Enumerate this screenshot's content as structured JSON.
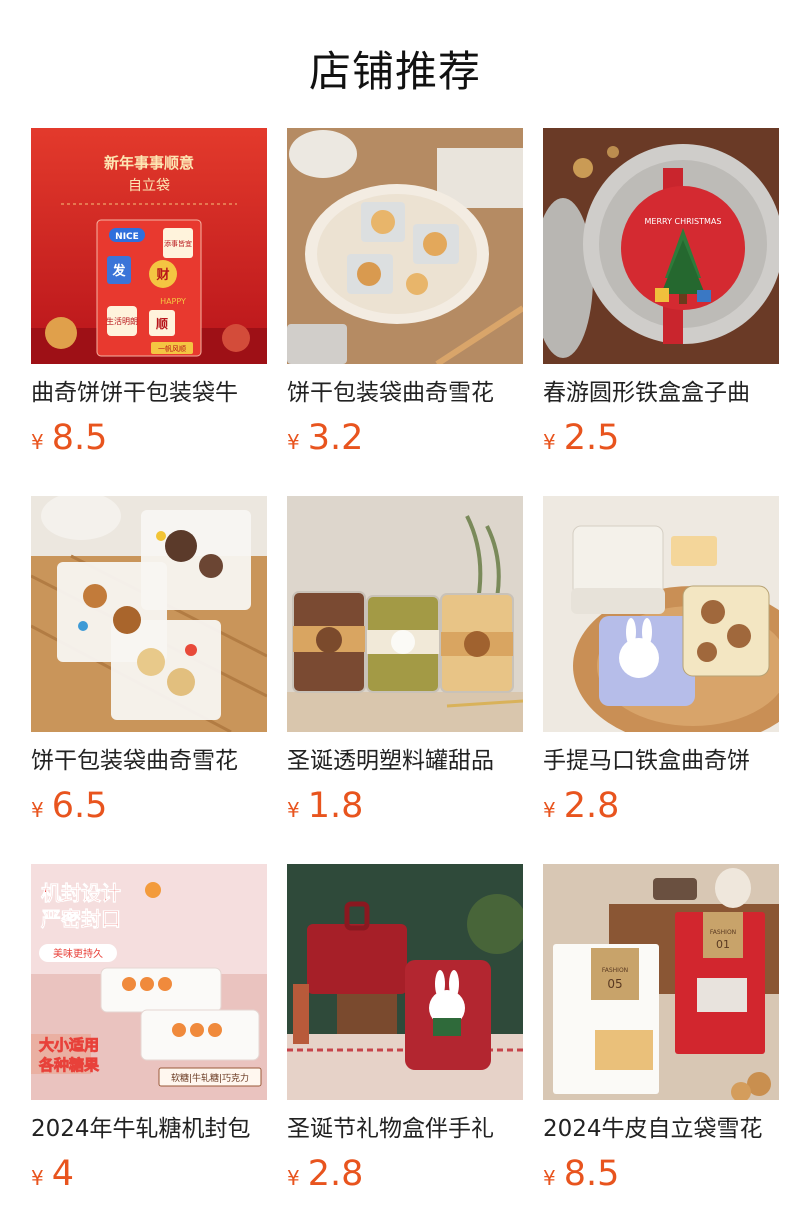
{
  "header": {
    "title": "店铺推荐"
  },
  "theme": {
    "price_color": "#e8541e"
  },
  "products": [
    {
      "name": "曲奇饼饼干包装袋牛",
      "currency": "¥",
      "price": "8.5",
      "image_texts": [
        "新年事事顺意",
        "自立袋",
        "NICE",
        "添事皆宜",
        "发",
        "财",
        "HAPPY",
        "生活明朗",
        "顺",
        "一帆风顺"
      ]
    },
    {
      "name": "饼干包装袋曲奇雪花",
      "currency": "¥",
      "price": "3.2",
      "image_texts": []
    },
    {
      "name": "春游圆形铁盒盒子曲",
      "currency": "¥",
      "price": "2.5",
      "image_texts": [
        "MERRY CHRISTMAS"
      ]
    },
    {
      "name": "饼干包装袋曲奇雪花",
      "currency": "¥",
      "price": "6.5",
      "image_texts": []
    },
    {
      "name": "圣诞透明塑料罐甜品",
      "currency": "¥",
      "price": "1.8",
      "image_texts": []
    },
    {
      "name": "手提马口铁盒曲奇饼",
      "currency": "¥",
      "price": "2.8",
      "image_texts": []
    },
    {
      "name": "2024年牛轧糖机封包",
      "currency": "¥",
      "price": "4",
      "image_texts": [
        "机封设计",
        "严密封口",
        "美味更持久",
        "大小适用",
        "各种糖果",
        "软糖|牛轧糖|巧克力"
      ]
    },
    {
      "name": "圣诞节礼物盒伴手礼",
      "currency": "¥",
      "price": "2.8",
      "image_texts": []
    },
    {
      "name": "2024牛皮自立袋雪花",
      "currency": "¥",
      "price": "8.5",
      "image_texts": [
        "FASHION",
        "01",
        "FASHION",
        "05"
      ]
    }
  ]
}
